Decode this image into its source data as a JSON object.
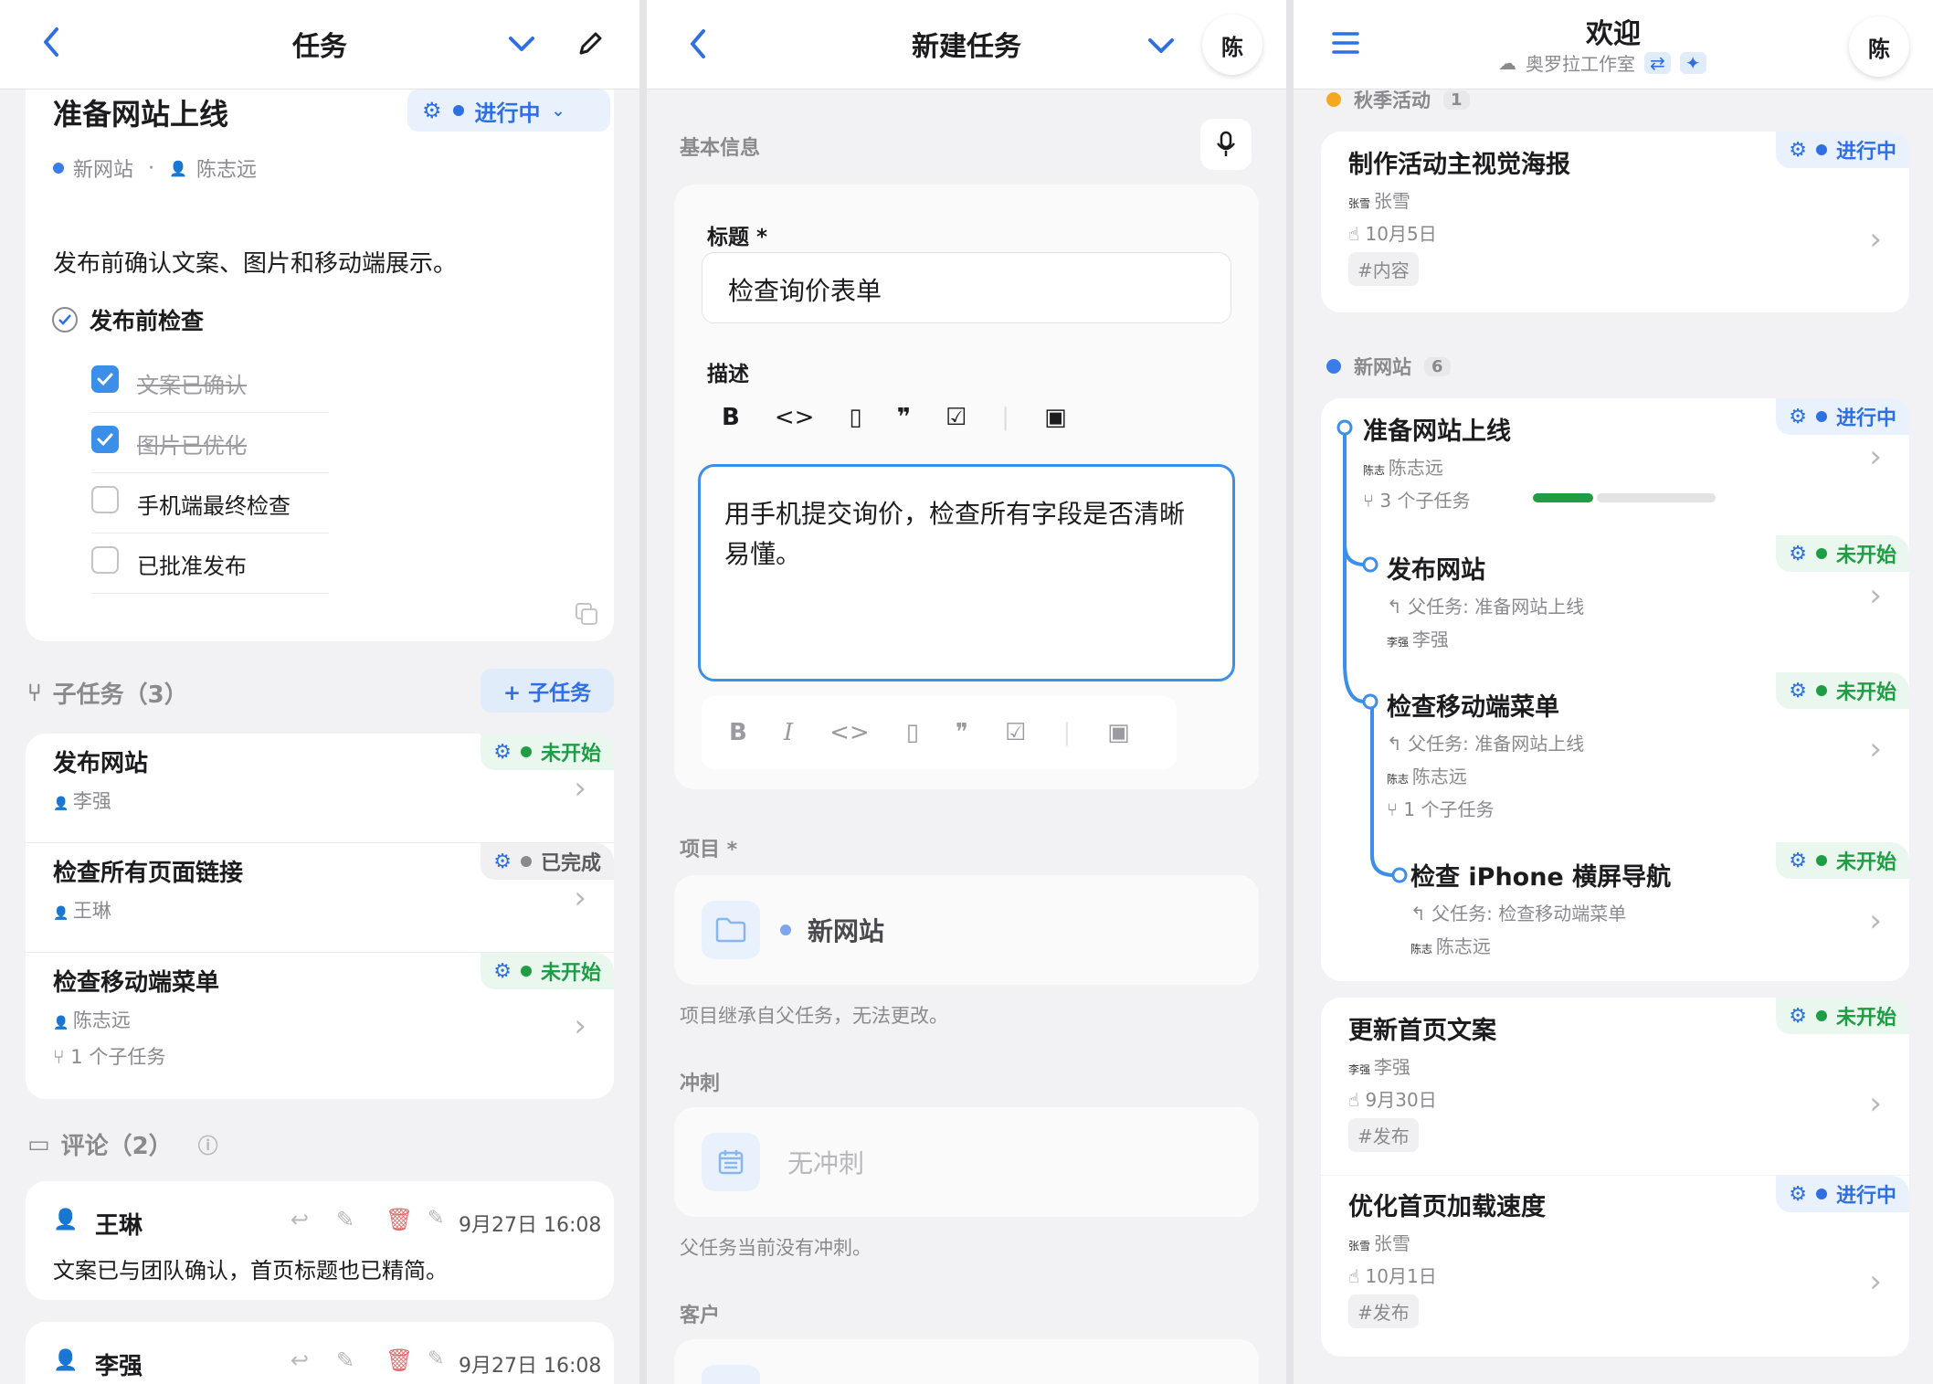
{
  "colors": {
    "accent": "#2f6fe4",
    "in_progress": "#2f6fe4",
    "not_started": "#1f9d45",
    "done": "#8a8a8e",
    "orange": "#f5a623",
    "progress": "#1f9d45"
  },
  "p1": {
    "title": "任务",
    "task_title": "准备网站上线",
    "status": "进行中",
    "project": "新网站",
    "assignee": "陈志远",
    "description": "发布前确认文案、图片和移动端展示。",
    "checklist_title": "发布前检查",
    "checklist": [
      {
        "label": "文案已确认",
        "checked": true
      },
      {
        "label": "图片已优化",
        "checked": true
      },
      {
        "label": "手机端最终检查",
        "checked": false
      },
      {
        "label": "已批准发布",
        "checked": false
      }
    ],
    "subtasks_header": "子任务（3）",
    "add_subtask": "+ 子任务",
    "subtasks": [
      {
        "title": "发布网站",
        "assignee": "李强",
        "status": "未开始"
      },
      {
        "title": "检查所有页面链接",
        "assignee": "王琳",
        "status": "已完成"
      },
      {
        "title": "检查移动端菜单",
        "assignee": "陈志远",
        "status": "未开始",
        "sub": "1 个子任务"
      }
    ],
    "comments_header": "评论（2）",
    "comments": [
      {
        "author": "王琳",
        "time": "9月27日 16:08",
        "text": "文案已与团队确认，首页标题也已精简。"
      },
      {
        "author": "李强",
        "time": "9月27日 16:08"
      }
    ]
  },
  "p2": {
    "title": "新建任务",
    "avatar": "陈",
    "basic_info": "基本信息",
    "title_label": "标题 *",
    "title_value": "检查询价表单",
    "desc_label": "描述",
    "desc_value": "用手机提交询价，检查所有字段是否清晰易懂。",
    "project_label": "项目 *",
    "project_value": "新网站",
    "project_note": "项目继承自父任务，无法更改。",
    "sprint_label": "冲刺",
    "sprint_value": "无冲刺",
    "sprint_note": "父任务当前没有冲刺。",
    "customer_label": "客户"
  },
  "p3": {
    "title": "欢迎",
    "workspace": "奥罗拉工作室",
    "avatar": "陈",
    "groups": [
      {
        "name": "秋季活动",
        "count": "1"
      },
      {
        "name": "新网站",
        "count": "6"
      }
    ],
    "tasks": [
      {
        "title": "制作活动主视觉海报",
        "assignee": "张雪",
        "date": "10月5日",
        "tag": "#内容",
        "status": "进行中"
      },
      {
        "title": "准备网站上线",
        "assignee": "陈志远",
        "sub": "3 个子任务",
        "status": "进行中",
        "progress": 0.33
      },
      {
        "title": "发布网站",
        "parent": "父任务: 准备网站上线",
        "assignee": "李强",
        "status": "未开始"
      },
      {
        "title": "检查移动端菜单",
        "parent": "父任务: 准备网站上线",
        "assignee": "陈志远",
        "sub": "1 个子任务",
        "status": "未开始"
      },
      {
        "title": "检查 iPhone 横屏导航",
        "parent": "父任务: 检查移动端菜单",
        "assignee": "陈志远",
        "status": "未开始"
      },
      {
        "title": "更新首页文案",
        "assignee": "李强",
        "date": "9月30日",
        "tag": "#发布",
        "status": "未开始"
      },
      {
        "title": "优化首页加载速度",
        "assignee": "张雪",
        "date": "10月1日",
        "tag": "#发布",
        "status": "进行中"
      }
    ]
  }
}
